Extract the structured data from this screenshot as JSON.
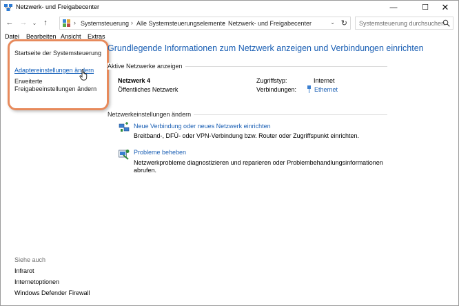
{
  "window": {
    "title": "Netzwerk- und Freigabecenter",
    "controls": {
      "minimize": "—",
      "maximize": "☐",
      "close": "✕"
    }
  },
  "address_bar": {
    "breadcrumbs": [
      "Systemsteuerung",
      "Alle Systemsteuerungselemente",
      "Netzwerk- und Freigabecenter"
    ],
    "search_placeholder": "Systemsteuerung durchsuchen"
  },
  "menu": [
    "Datei",
    "Bearbeiten",
    "Ansicht",
    "Extras"
  ],
  "sidebar": {
    "links": [
      "Startseite der Systemsteuerung",
      "Adaptereinstellungen ändern",
      "Erweiterte",
      "Freigabeeinstellungen ändern"
    ],
    "see_also_heading": "Siehe auch",
    "see_also": [
      "Infrarot",
      "Internetoptionen",
      "Windows Defender Firewall"
    ]
  },
  "main": {
    "title": "Grundlegende Informationen zum Netzwerk anzeigen und Verbindungen einrichten",
    "active_networks_label": "Aktive Netzwerke anzeigen",
    "network": {
      "name": "Netzwerk  4",
      "type": "Öffentliches Netzwerk",
      "access_type_label": "Zugriffstyp:",
      "access_type_value": "Internet",
      "connections_label": "Verbindungen:",
      "connections_value": "Ethernet"
    },
    "change_settings_label": "Netzwerkeinstellungen ändern",
    "tasks": [
      {
        "link": "Neue Verbindung oder neues Netzwerk einrichten",
        "description": "Breitband-, DFÜ- oder VPN-Verbindung bzw. Router oder Zugriffspunkt einrichten.",
        "icon": "new-connection-icon"
      },
      {
        "link": "Probleme beheben",
        "description_line1": "Netzwerkprobleme diagnostizieren und reparieren oder Problembehandlungsinformationen",
        "description_line2": "abrufen.",
        "icon": "troubleshoot-icon"
      }
    ]
  },
  "colors": {
    "link_blue": "#1a5fb4",
    "highlight_orange": "#e78a5c"
  }
}
